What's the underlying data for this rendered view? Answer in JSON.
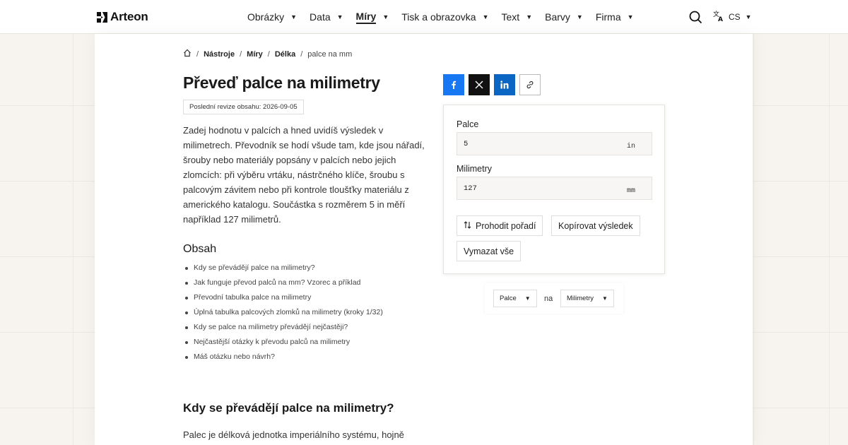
{
  "header": {
    "brand": "Arteon",
    "nav": [
      {
        "label": "Obrázky",
        "active": false
      },
      {
        "label": "Data",
        "active": false
      },
      {
        "label": "Míry",
        "active": true
      },
      {
        "label": "Tisk a obrazovka",
        "active": false
      },
      {
        "label": "Text",
        "active": false
      },
      {
        "label": "Barvy",
        "active": false
      },
      {
        "label": "Firma",
        "active": false
      }
    ],
    "language": "CS",
    "icons": {
      "search": "search-icon",
      "language": "translate-icon",
      "home": "home-icon"
    }
  },
  "breadcrumb": {
    "items": [
      "Nástroje",
      "Míry",
      "Délka"
    ],
    "current": "palce na mm"
  },
  "page": {
    "title": "Převeď palce na milimetry",
    "revision": "Poslední revize obsahu: 2026-09-05",
    "intro": "Zadej hodnotu v palcích a hned uvidíš výsledek v milimetrech. Převodník se hodí všude tam, kde jsou nářadí, šrouby nebo materiály popsány v palcích nebo jejich zlomcích: při výběru vrtáku, nástrčného klíče, šroubu s palcovým závitem nebo při kontrole tloušťky materiálu z amerického katalogu. Součástka s rozměrem 5 in měří například 127 milimetrů.",
    "toc_title": "Obsah",
    "toc": [
      "Kdy se převádějí palce na milimetry?",
      "Jak funguje převod palců na mm? Vzorec a příklad",
      "Převodní tabulka palce na milimetry",
      "Úplná tabulka palcových zlomků na milimetry (kroky 1/32)",
      "Kdy se palce na milimetry převádějí nejčastěji?",
      "Nejčastější otázky k převodu palců na milimetry",
      "Máš otázku nebo návrh?"
    ],
    "section_title": "Kdy se převádějí palce na milimetry?",
    "section_text": "Palec je délková jednotka imperiálního systému, hojně"
  },
  "share": {
    "icons": [
      "facebook-icon",
      "x-icon",
      "linkedin-icon",
      "link-icon"
    ],
    "colors": {
      "facebook": "#1877f2",
      "x": "#111111",
      "linkedin": "#0a66c2"
    }
  },
  "converter": {
    "from_label": "Palce",
    "from_value": "5",
    "from_unit": "in",
    "to_label": "Milimetry",
    "to_value": "127",
    "to_unit": "mm",
    "swap_label": "Prohodit pořadí",
    "copy_label": "Kopírovat výsledek",
    "clear_label": "Vymazat vše"
  },
  "unit_select": {
    "from": "Palce",
    "joiner": "na",
    "to": "Milimetry"
  }
}
